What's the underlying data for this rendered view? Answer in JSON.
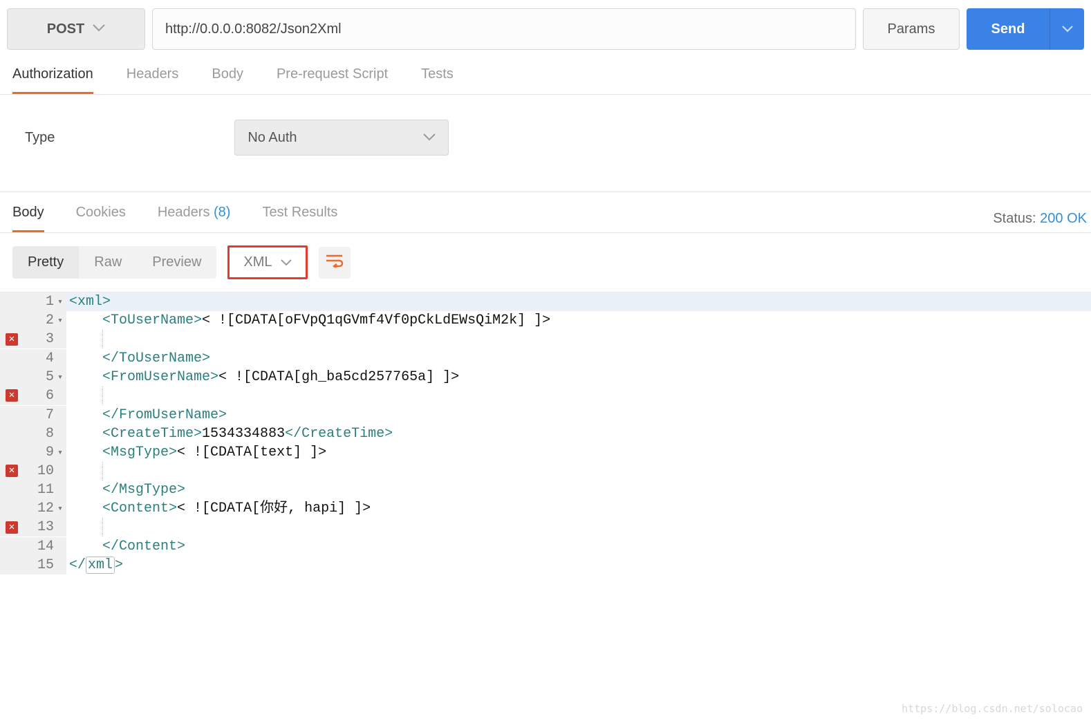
{
  "request": {
    "method": "POST",
    "url": "http://0.0.0.0:8082/Json2Xml",
    "params_label": "Params",
    "send_label": "Send"
  },
  "req_tabs": {
    "authorization": "Authorization",
    "headers": "Headers",
    "body": "Body",
    "prerequest": "Pre-request Script",
    "tests": "Tests"
  },
  "auth": {
    "type_label": "Type",
    "selected": "No Auth"
  },
  "resp_tabs": {
    "body": "Body",
    "cookies": "Cookies",
    "headers_label": "Headers ",
    "headers_count": "(8)",
    "testresults": "Test Results"
  },
  "status": {
    "label": "Status:",
    "value": "200 OK"
  },
  "view": {
    "pretty": "Pretty",
    "raw": "Raw",
    "preview": "Preview",
    "format": "XML"
  },
  "code": {
    "l1": "<xml>",
    "l2a": "<ToUserName>",
    "l2b": "< ![CDATA[oFVpQ1qGVmf4Vf0pCkLdEWsQiM2k] ]>",
    "l4": "</ToUserName>",
    "l5a": "<FromUserName>",
    "l5b": "< ![CDATA[gh_ba5cd257765a] ]>",
    "l7": "</FromUserName>",
    "l8a": "<CreateTime>",
    "l8b": "1534334883",
    "l8c": "</CreateTime>",
    "l9a": "<MsgType>",
    "l9b": "< ![CDATA[text] ]>",
    "l11": "</MsgType>",
    "l12a": "<Content>",
    "l12b": "< ![CDATA[你好, hapi] ]>",
    "l14": "</Content>",
    "l15a": "</",
    "l15b": "xml",
    "l15c": ">"
  },
  "watermark": "https://blog.csdn.net/solocao"
}
